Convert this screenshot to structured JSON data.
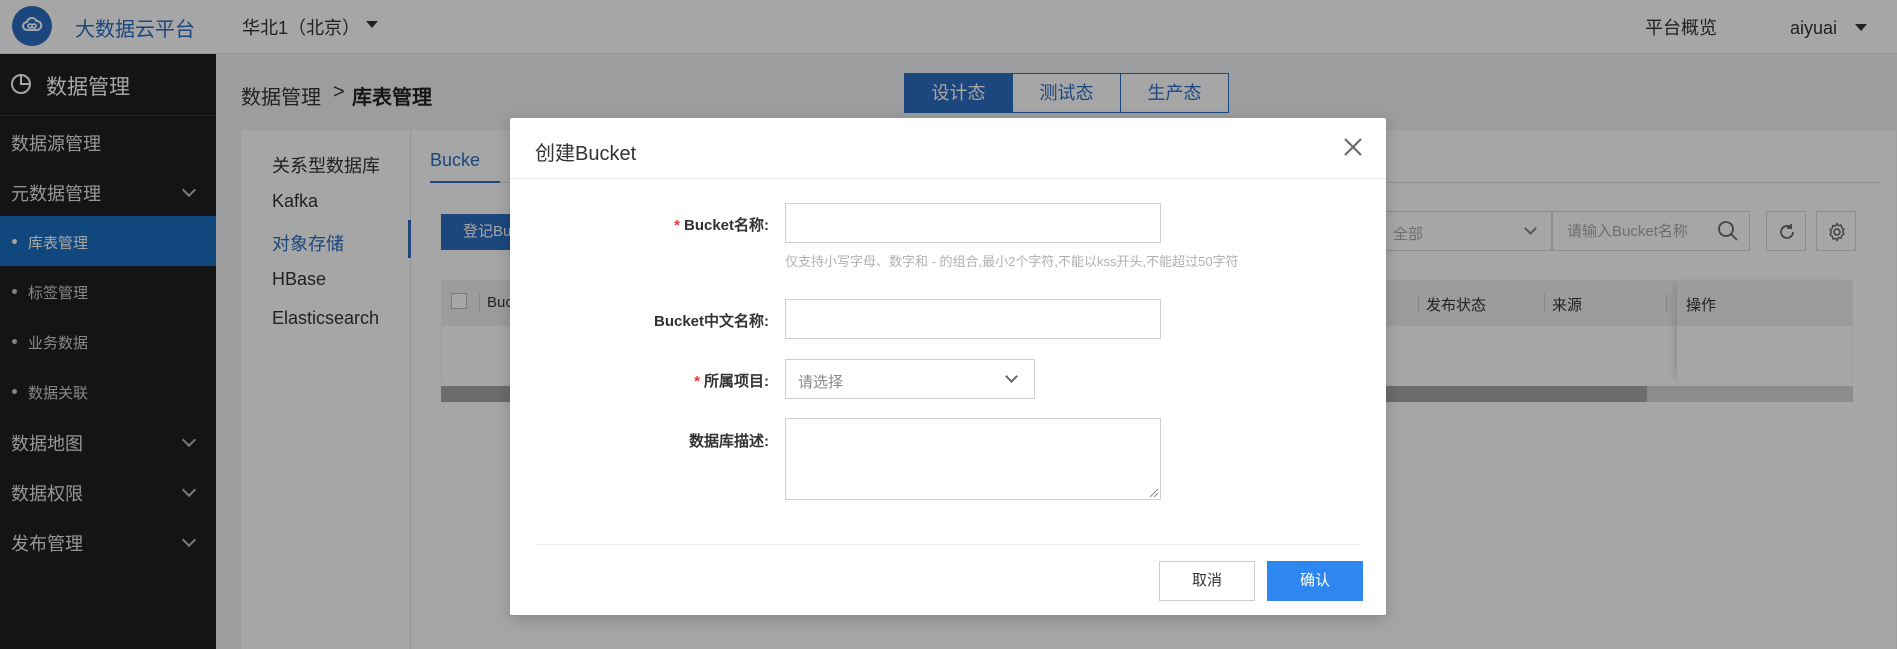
{
  "header": {
    "logo_icon": "cloud-link-icon",
    "app_title": "大数据云平台",
    "region": "华北1（北京）",
    "nav_overview": "平台概览",
    "username": "aiyuai"
  },
  "sidebar": {
    "section_title": "数据管理",
    "section_icon": "pie-chart-icon",
    "items": [
      {
        "label": "数据源管理"
      },
      {
        "label": "元数据管理"
      },
      {
        "label": "库表管理"
      },
      {
        "label": "标签管理"
      },
      {
        "label": "业务数据"
      },
      {
        "label": "数据关联"
      },
      {
        "label": "数据地图"
      },
      {
        "label": "数据权限"
      },
      {
        "label": "发布管理"
      }
    ],
    "active": "库表管理"
  },
  "breadcrumb": {
    "parent": "数据管理",
    "separator": ">",
    "current": "库表管理"
  },
  "env_tabs": [
    {
      "label": "设计态",
      "active": true
    },
    {
      "label": "测试态",
      "active": false
    },
    {
      "label": "生产态",
      "active": false
    }
  ],
  "store_types": [
    "关系型数据库",
    "Kafka",
    "对象存储",
    "HBase",
    "Elasticsearch"
  ],
  "active_store_type": "对象存储",
  "main": {
    "tab_label": "Bucke",
    "register_button": "登记Bu",
    "filter_value": "全部",
    "search_placeholder": "请输入Bucket名称",
    "columns": [
      "Buc",
      "发布状态",
      "来源",
      "操作"
    ]
  },
  "modal": {
    "title": "创建Bucket",
    "fields": {
      "name_label": "Bucket名称:",
      "name_value": "",
      "name_hint": "仅支持小写字母、数字和 - 的组合,最小2个字符,不能以kss开头,不能超过50字符",
      "cn_name_label": "Bucket中文名称:",
      "cn_name_value": "",
      "project_label": "所属项目:",
      "project_placeholder": "请选择",
      "desc_label": "数据库描述:",
      "desc_value": ""
    },
    "cancel_label": "取消",
    "confirm_label": "确认"
  },
  "colors": {
    "primary": "#2a6ec2",
    "confirm": "#2e86f0",
    "sidebar_bg": "#1f1f1f",
    "required": "#e53935"
  }
}
